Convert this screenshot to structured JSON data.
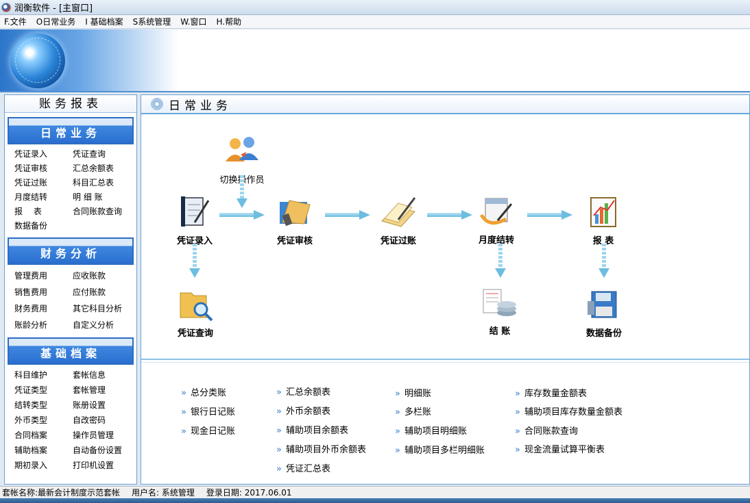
{
  "window": {
    "title": "润衡软件 - [主窗口]"
  },
  "menu": [
    "F.文件",
    "O日常业务",
    "I 基础档案",
    "S系统管理",
    "W.窗口",
    "H.帮助"
  ],
  "sidebar": {
    "header": "账务报表",
    "sections": [
      {
        "title": "日常业务",
        "items": [
          "凭证录入",
          "凭证查询",
          "凭证审核",
          "汇总余额表",
          "凭证过账",
          "科目汇总表",
          "月度结转",
          "明 细 账",
          "报　 表",
          "合同账款查询",
          "数据备份"
        ]
      },
      {
        "title": "财务分析",
        "items": [
          "管理费用",
          "应收账款",
          "销售费用",
          "应付账款",
          "财务费用",
          "其它科目分析",
          "账龄分析",
          "自定义分析"
        ]
      },
      {
        "title": "基础档案",
        "items": [
          "科目维护",
          "套帐信息",
          "凭证类型",
          "套帐管理",
          "结转类型",
          "账册设置",
          "外币类型",
          "自改密码",
          "合同档案",
          "操作员管理",
          "辅助档案",
          "自动备份设置",
          "期初录入",
          "打印机设置"
        ]
      }
    ]
  },
  "main": {
    "title": "日常业务",
    "flow": {
      "switch_operator": "切换操作员",
      "voucher_entry": "凭证录入",
      "voucher_audit": "凭证审核",
      "voucher_post": "凭证过账",
      "month_close": "月度结转",
      "report": "报 表",
      "voucher_query": "凭证查询",
      "closing": "结 账",
      "backup": "数据备份"
    },
    "reports": {
      "col1": [
        "总分类账",
        "银行日记账",
        "现金日记账"
      ],
      "col2": [
        "汇总余额表",
        "外币余额表",
        "辅助项目余额表",
        "辅助项目外币余额表",
        "凭证汇总表"
      ],
      "col3": [
        "明细账",
        "多栏账",
        "辅助项目明细账",
        "辅助项目多栏明细账"
      ],
      "col4": [
        "库存数量金额表",
        "辅助项目库存数量金额表",
        "合同账款查询",
        "现金流量试算平衡表"
      ]
    }
  },
  "status": {
    "account": "套帐名称:最新会计制度示范套帐",
    "user": "用户名: 系统管理",
    "login_date": "登录日期: 2017.06.01"
  }
}
